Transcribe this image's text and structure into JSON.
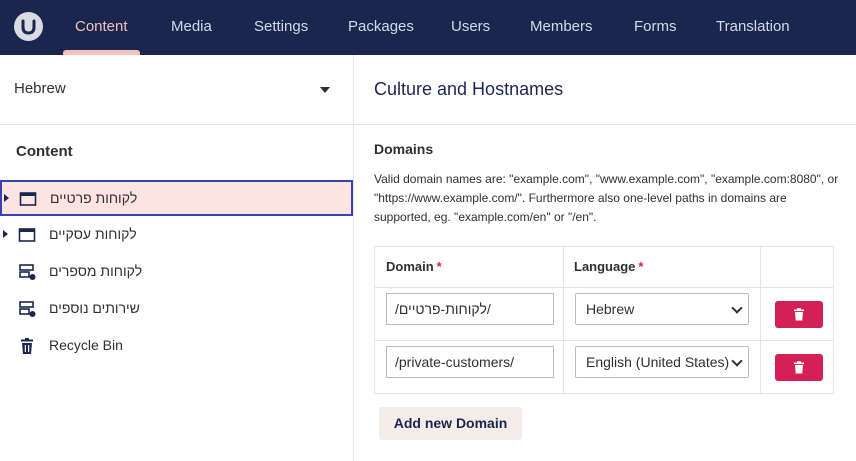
{
  "topnav": {
    "items": [
      {
        "label": "Content",
        "active": true
      },
      {
        "label": "Media",
        "active": false
      },
      {
        "label": "Settings",
        "active": false
      },
      {
        "label": "Packages",
        "active": false
      },
      {
        "label": "Users",
        "active": false
      },
      {
        "label": "Members",
        "active": false
      },
      {
        "label": "Forms",
        "active": false
      },
      {
        "label": "Translation",
        "active": false
      }
    ]
  },
  "sidebar": {
    "language": "Hebrew",
    "tree_title": "Content",
    "items": [
      {
        "label": "לקוחות פרטיים",
        "icon": "window-icon",
        "expandable": true,
        "selected": true
      },
      {
        "label": "לקוחות עסקיים",
        "icon": "window-icon",
        "expandable": true,
        "selected": false
      },
      {
        "label": "לקוחות מספרים",
        "icon": "server-add-icon",
        "expandable": false,
        "selected": false
      },
      {
        "label": "שירותים נוספים",
        "icon": "server-add-icon",
        "expandable": false,
        "selected": false
      },
      {
        "label": "Recycle Bin",
        "icon": "trash-icon",
        "expandable": false,
        "selected": false
      }
    ]
  },
  "panel": {
    "title": "Culture and Hostnames",
    "section_title": "Domains",
    "description": "Valid domain names are: \"example.com\", \"www.example.com\", \"example.com:8080\", or \"https://www.example.com/\". Furthermore also one-level paths in domains are supported, eg. \"example.com/en\" or \"/en\".",
    "table": {
      "col_domain": "Domain",
      "col_language": "Language",
      "required_mark": "*",
      "rows": [
        {
          "domain": "/לקוחות-פרטיים/",
          "language": "Hebrew"
        },
        {
          "domain": "/private-customers/",
          "language": "English (United States)"
        }
      ]
    },
    "add_button": "Add new Domain"
  },
  "colors": {
    "nav_bg": "#1b264f",
    "accent": "#f5c1bc",
    "danger": "#d42054",
    "selected_bg": "#fde4e1",
    "selected_border": "#3544b1"
  }
}
